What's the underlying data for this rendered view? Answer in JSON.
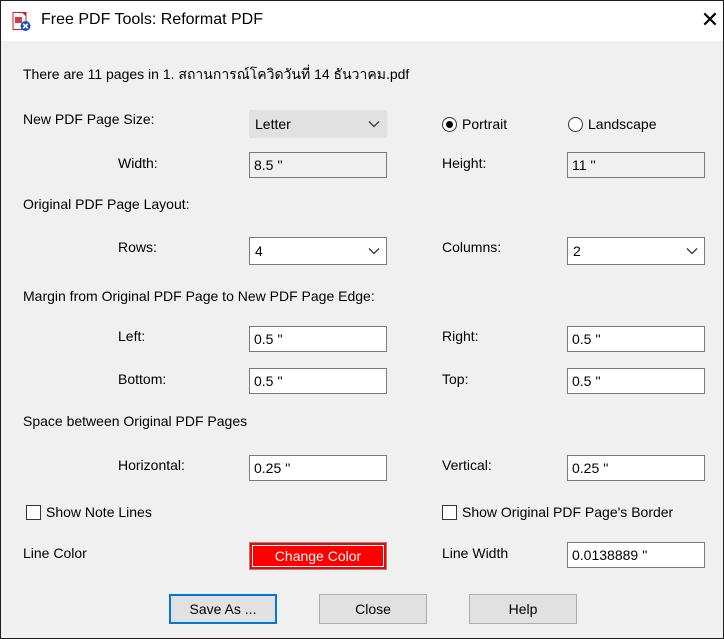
{
  "window": {
    "title": "Free PDF Tools: Reformat PDF",
    "close_label": "✕"
  },
  "info_text": "There are 11 pages in 1. สถานการณ์โควิดวันที่ 14 ธันวาคม.pdf",
  "new_page": {
    "size_label": "New PDF Page Size:",
    "size_value": "Letter",
    "portrait_label": "Portrait",
    "landscape_label": "Landscape",
    "orientation_selected": "Portrait",
    "width_label": "Width:",
    "width_value": "8.5 ''",
    "height_label": "Height:",
    "height_value": "11 ''"
  },
  "layout": {
    "section_label": "Original PDF Page Layout:",
    "rows_label": "Rows:",
    "rows_value": "4",
    "columns_label": "Columns:",
    "columns_value": "2"
  },
  "margin": {
    "section_label": "Margin from Original PDF Page to New PDF Page Edge:",
    "left_label": "Left:",
    "left_value": "0.5 ''",
    "right_label": "Right:",
    "right_value": "0.5 ''",
    "bottom_label": "Bottom:",
    "bottom_value": "0.5 ''",
    "top_label": "Top:",
    "top_value": "0.5 ''"
  },
  "space": {
    "section_label": "Space between Original PDF Pages",
    "horizontal_label": "Horizontal:",
    "horizontal_value": "0.25 ''",
    "vertical_label": "Vertical:",
    "vertical_value": "0.25 ''"
  },
  "options": {
    "show_note_lines_label": "Show Note Lines",
    "show_note_lines_checked": false,
    "show_border_label": "Show Original PDF Page's Border",
    "show_border_checked": false,
    "line_color_label": "Line Color",
    "change_color_label": "Change Color",
    "line_color_value": "#ff0000",
    "line_width_label": "Line Width",
    "line_width_value": "0.0138889 ''"
  },
  "buttons": {
    "save_as": "Save As ...",
    "close": "Close",
    "help": "Help"
  },
  "icons": {
    "app": "pdf-tools-icon",
    "dropdown": "chevron-down-icon"
  }
}
